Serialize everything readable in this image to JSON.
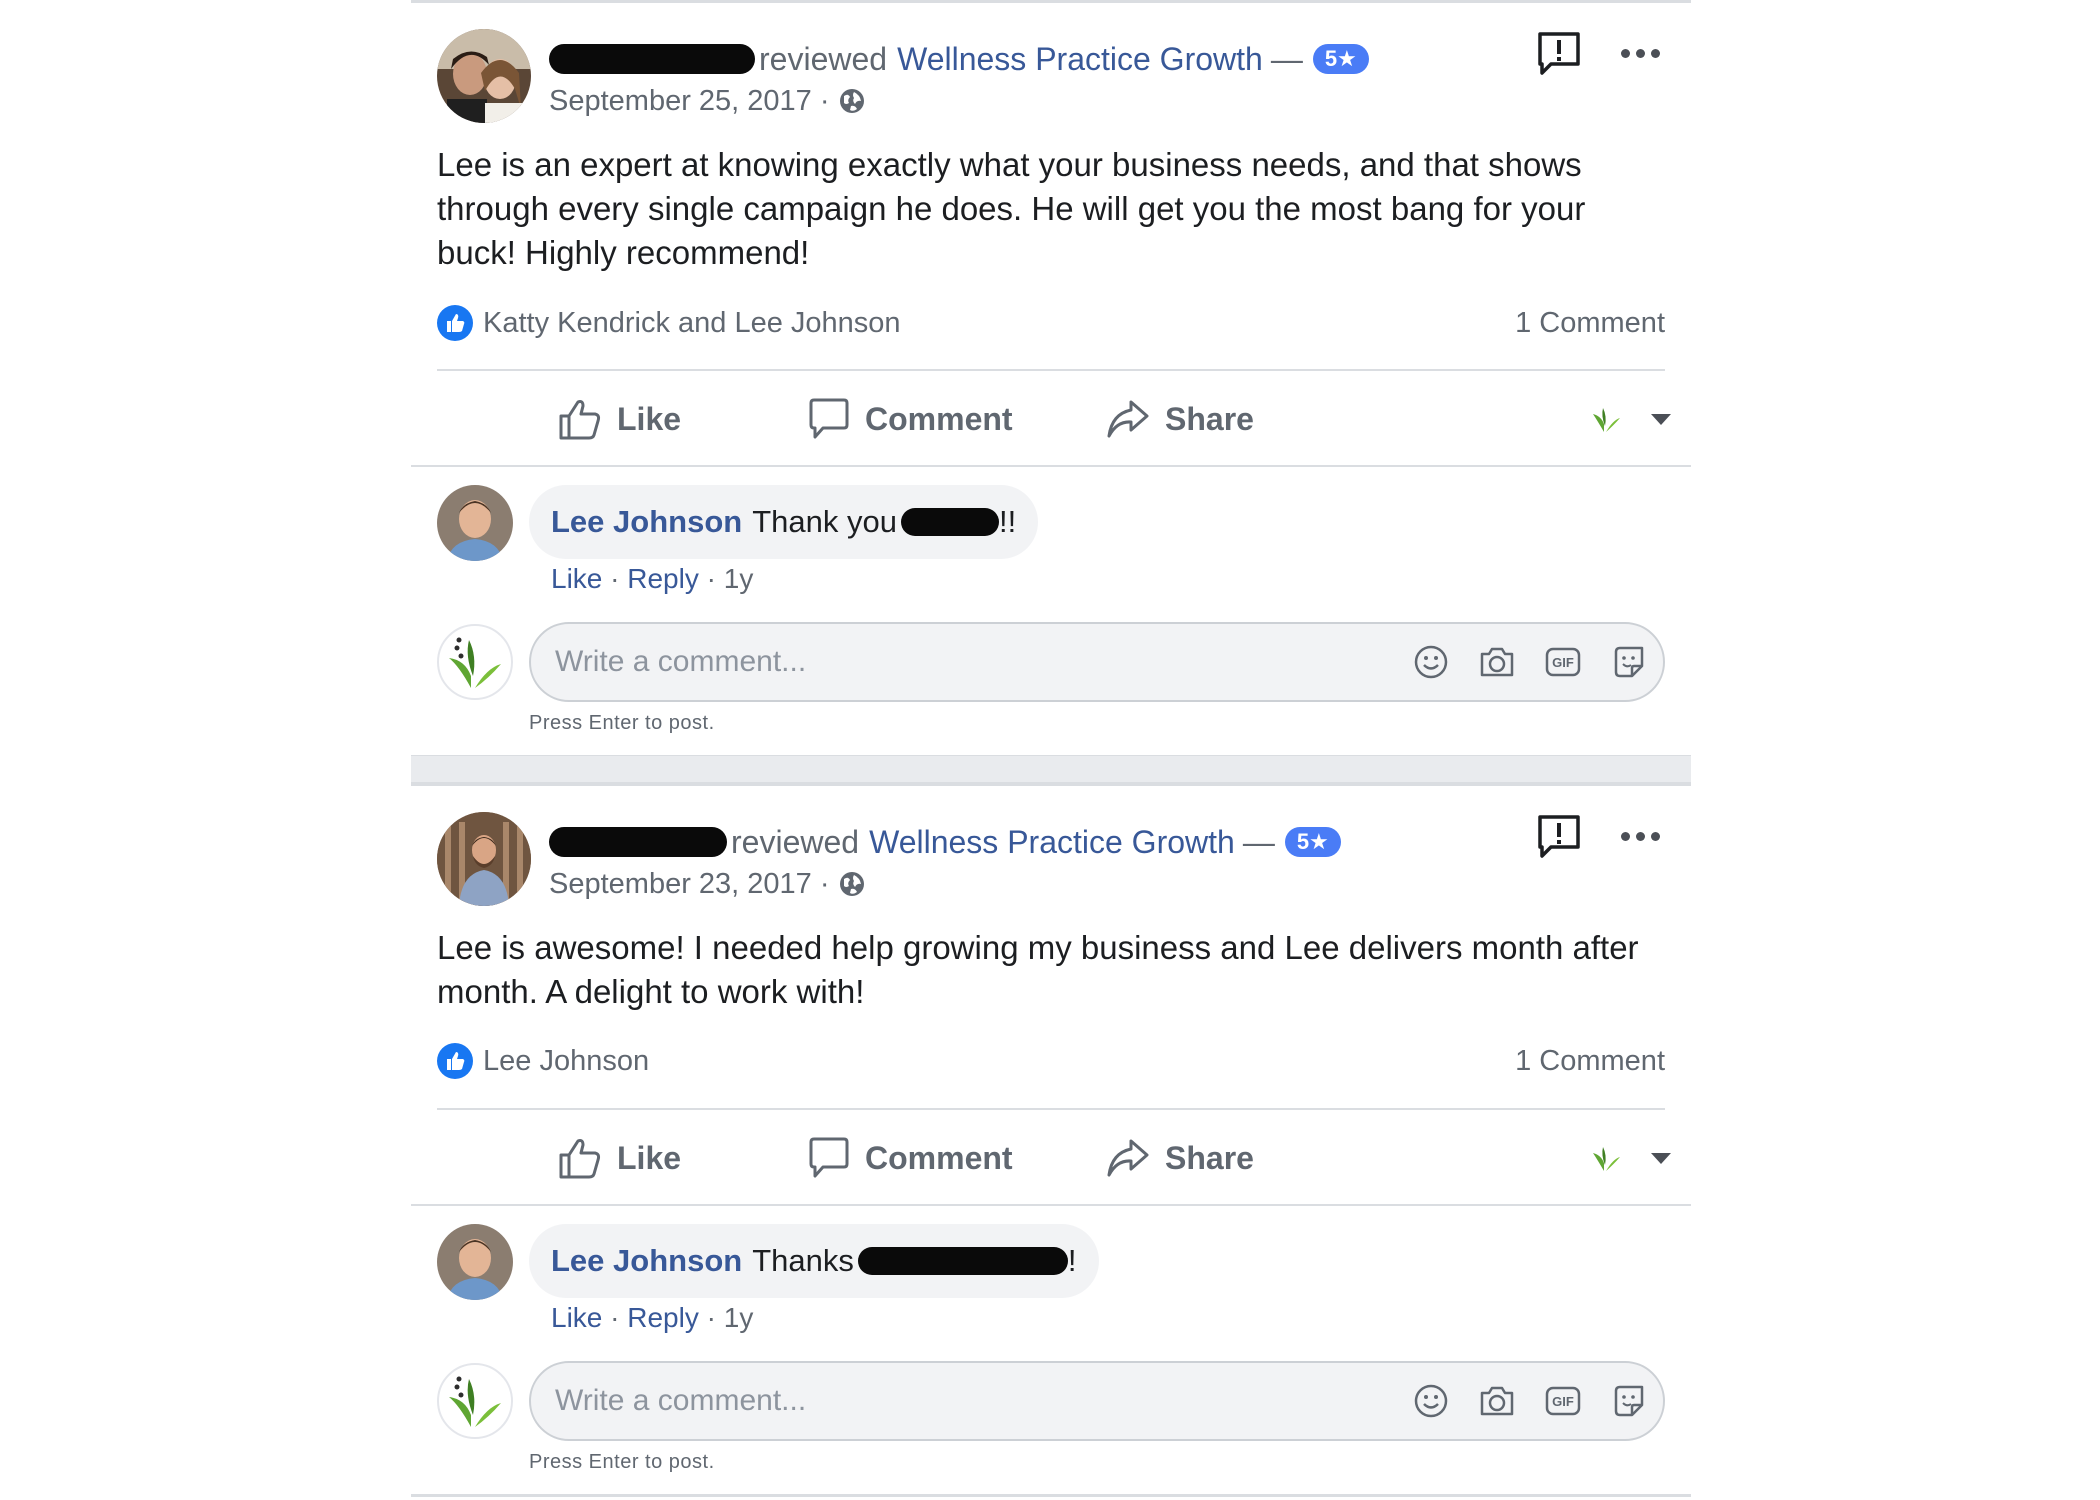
{
  "posts": [
    {
      "reviewed_text": "reviewed",
      "page_name": "Wellness Practice Growth",
      "dash": "—",
      "rating_badge": "5★",
      "date": "September 25, 2017 ·",
      "review_text": "Lee is an expert at knowing exactly what your business needs, and that shows through every single campaign he does. He will get you the most bang for your buck! Highly recommend!",
      "likers": "Katty Kendrick and Lee Johnson",
      "comment_count": "1 Comment",
      "actions": {
        "like": "Like",
        "comment": "Comment",
        "share": "Share"
      },
      "comment": {
        "author": "Lee Johnson",
        "text_before": "Thank you",
        "text_after": "!!",
        "like": "Like",
        "reply": "Reply",
        "sep": "·",
        "age": "1y"
      },
      "composer": {
        "placeholder": "Write a comment...",
        "hint": "Press Enter to post.",
        "gif": "GIF"
      }
    },
    {
      "reviewed_text": "reviewed",
      "page_name": "Wellness Practice Growth",
      "dash": "—",
      "rating_badge": "5★",
      "date": "September 23, 2017 ·",
      "review_text": "Lee is awesome! I needed help growing my business and Lee delivers month after month. A delight to work with!",
      "likers": "Lee Johnson",
      "comment_count": "1 Comment",
      "actions": {
        "like": "Like",
        "comment": "Comment",
        "share": "Share"
      },
      "comment": {
        "author": "Lee Johnson",
        "text_before": "Thanks",
        "text_after": "!",
        "like": "Like",
        "reply": "Reply",
        "sep": "·",
        "age": "1y"
      },
      "composer": {
        "placeholder": "Write a comment...",
        "hint": "Press Enter to post.",
        "gif": "GIF"
      }
    }
  ],
  "colors": {
    "link": "#385898",
    "rating_badge": "#4a7cf6",
    "like_blue": "#1877f2",
    "muted_text": "#606770",
    "separator": "#e9ebee"
  },
  "icons": [
    "report-icon",
    "more-icon",
    "globe-icon",
    "like-reaction-icon",
    "thumbs-up-icon",
    "comment-icon",
    "share-icon",
    "page-logo-icon",
    "chevron-down-icon",
    "emoji-icon",
    "camera-icon",
    "gif-icon",
    "sticker-icon"
  ]
}
